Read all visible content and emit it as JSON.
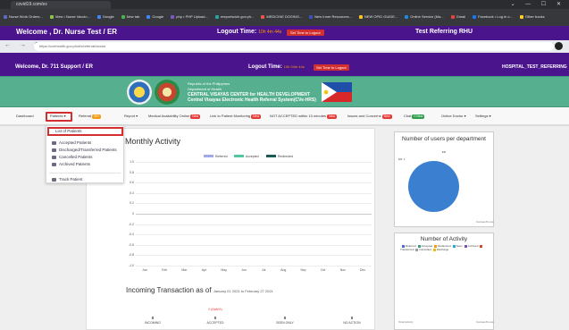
{
  "outer_browser": {
    "tab_title": "covid19.com/ex",
    "window_buttons": "⌄ — ☐ ✕",
    "bookmarks": [
      {
        "label": "Nurse Work Orders...",
        "color": "#5c6bc0"
      },
      {
        "label": "View • Nurse Vaccin...",
        "color": "#8bc34a"
      },
      {
        "label": "Google",
        "color": "#4285f4"
      },
      {
        "label": "New tab",
        "color": "#4caf50"
      },
      {
        "label": "Google",
        "color": "#4285f4"
      },
      {
        "label": "php • PHP Upload...",
        "color": "#7e57c2"
      },
      {
        "label": "ereportsdoh.gov.ph...",
        "color": "#26a69a"
      },
      {
        "label": "MEDICINE DOSING...",
        "color": "#ef5350"
      },
      {
        "label": "New Inner Resources...",
        "color": "#3f51b5"
      },
      {
        "label": "NEW OPID GUIDE...",
        "color": "#fbc02d"
      },
      {
        "label": "Online Service (Ma...",
        "color": "#1e88e5"
      },
      {
        "label": "Gmail",
        "color": "#ea4335"
      },
      {
        "label": "Facebook • Log in o...",
        "color": "#1877f2"
      },
      {
        "label": "Other books",
        "color": "#ffca28"
      }
    ]
  },
  "app_header_1": {
    "welcome": "Welcome , Dr. Nurse Test / ER",
    "logout_label": "Logout Time:",
    "logout_time": "10h 4m 44s",
    "logout_button": "Set Time to Logout",
    "facility": "Test Referring RHU"
  },
  "inner_browser": {
    "nav_icons": "← → C",
    "url": "https://cvehealth.gov.ph/ehi/referral/doctor"
  },
  "app_header_2": {
    "welcome": "Welcome, Dr. 711 Support / ER",
    "logout_label": "Logout Time:",
    "logout_time": "10h 04m 44s",
    "logout_button": "Set Time to Logout",
    "facility": "HOSPITAL_TEST_REFERRING"
  },
  "banner": {
    "line1": "Republic of the Philippines",
    "line2": "Department of Health",
    "line3": "CENTRAL VISAYAS CENTER for HEALTH DEVELOPMENT",
    "line4": "Central Visayas Electronic Health Referral System(CVe-HRS)"
  },
  "nav": {
    "items": [
      {
        "label": "Dashboard"
      },
      {
        "label": "Patients ▾"
      },
      {
        "label": "Referral",
        "badge": "99+",
        "badge_color": "orange"
      },
      {
        "label": "Report ▾"
      },
      {
        "label": "Medical Availability Online",
        "badge": "New",
        "badge_color": "red"
      },
      {
        "label": "Link to Patient Monitoring",
        "badge": "New",
        "badge_color": "red"
      },
      {
        "label": "NOT ACCEPTED within 10 minutes",
        "badge": "New",
        "badge_color": "red"
      },
      {
        "label": "Issues and Concerns",
        "badge": "New",
        "badge_color": "red"
      },
      {
        "label": "Chat",
        "badge": "0 New",
        "badge_color": "green"
      },
      {
        "label": "Online Doctor ▾"
      },
      {
        "label": "Settings ▾"
      }
    ]
  },
  "patients_menu": {
    "items": [
      "List of Patients",
      "Accepted Patients",
      "Discharged/Transferred Patients",
      "Cancelled Patients",
      "Archived Patients",
      "Track Patient"
    ]
  },
  "chart_data": [
    {
      "type": "bar",
      "title": "Monthly Activity",
      "categories": [
        "Jan",
        "Feb",
        "Mar",
        "Apr",
        "May",
        "Jun",
        "Jul",
        "Aug",
        "Sep",
        "Oct",
        "Nov",
        "Dec"
      ],
      "series": [
        {
          "name": "Referred",
          "color": "#a3a8e8",
          "values": [
            0,
            0,
            0,
            0,
            0,
            0,
            0,
            0,
            0,
            0,
            0,
            0
          ]
        },
        {
          "name": "Accepted",
          "color": "#55c6a4",
          "values": [
            0,
            0,
            0,
            0,
            0,
            0,
            0,
            0,
            0,
            0,
            0,
            0
          ]
        },
        {
          "name": "Redirected",
          "color": "#1a5c52",
          "values": [
            0,
            0,
            0,
            0,
            0,
            0,
            0,
            0,
            0,
            0,
            0,
            0
          ]
        }
      ],
      "yticks": [
        "1.0",
        "0.8",
        "0.6",
        "0.4",
        "0.2",
        "0",
        "-0.2",
        "-0.4",
        "-0.6",
        "-0.8",
        "-1.0"
      ],
      "ylim": [
        -1.0,
        1.0
      ],
      "legend": "top-center",
      "grid": true
    },
    {
      "type": "pie",
      "title": "Number of users per department",
      "legend_label": "ER",
      "slice_label": "ER: 1",
      "categories": [
        "ER"
      ],
      "values": [
        1
      ],
      "colors": [
        "#3a7fd0"
      ],
      "credit": "CanvasJS.com"
    },
    {
      "type": "pie",
      "title": "Number of Activity",
      "legend": [
        "Referred",
        "Accepted",
        "Redirected",
        "Seen",
        "Archived",
        "Transferred",
        "Cancelled",
        "Discharge"
      ],
      "legend_colors": [
        "#4b6cd8",
        "#3aa176",
        "#f39c12",
        "#2ba5d6",
        "#7a52b8",
        "#d6472b",
        "#9e9e9e",
        "#f5b800"
      ],
      "values": [
        0,
        0,
        0,
        0,
        0,
        0,
        0,
        0
      ],
      "credit": "CanvasJS.com",
      "footer_left": "Total Activity"
    }
  ],
  "transactions": {
    "title": "Incoming Transaction as of",
    "range": "January 01 2021 to February 27 2021",
    "accepted_extra": "0 (NaN%)",
    "stats": [
      {
        "value": "0",
        "label": "INCOMING"
      },
      {
        "value": "0",
        "label": "ACCEPTED"
      },
      {
        "value": "0",
        "label": "SEEN ONLY"
      },
      {
        "value": "0",
        "label": "NO ACTION"
      }
    ]
  }
}
